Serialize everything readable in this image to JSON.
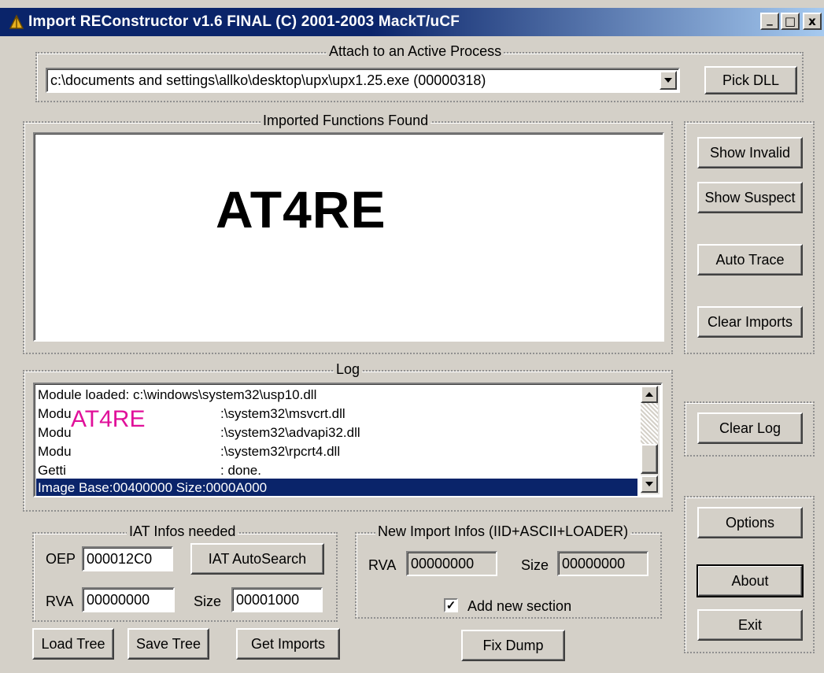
{
  "window": {
    "title": "Import REConstructor v1.6 FINAL (C) 2001-2003 MackT/uCF",
    "minimize": "_",
    "maximize": "□",
    "close": "x"
  },
  "attach": {
    "group_label": "Attach to an Active Process",
    "process": "c:\\documents and settings\\allko\\desktop\\upx\\upx1.25.exe (00000318)",
    "pick_dll": "Pick DLL"
  },
  "imports": {
    "group_label": "Imported Functions Found",
    "watermark": "AT4RE"
  },
  "right_panel": {
    "show_invalid": "Show Invalid",
    "show_suspect": "Show Suspect",
    "auto_trace": "Auto Trace",
    "clear_imports": "Clear Imports",
    "clear_log": "Clear Log",
    "options": "Options",
    "about": "About",
    "exit": "Exit"
  },
  "log": {
    "group_label": "Log",
    "lines": [
      "Module loaded: c:\\windows\\system32\\usp10.dll",
      "Modu",
      ":\\system32\\msvcrt.dll",
      "Modu",
      ":\\system32\\advapi32.dll",
      "Modu",
      ":\\system32\\rpcrt4.dll",
      "Getti",
      ": done."
    ],
    "selected": "Image Base:00400000 Size:0000A000",
    "watermark": "AT4RE",
    "watermark_color": "#e0109a"
  },
  "iat": {
    "group_label": "IAT Infos needed",
    "oep_label": "OEP",
    "oep_value": "000012C0",
    "autosearch": "IAT AutoSearch",
    "rva_label": "RVA",
    "rva_value": "00000000",
    "size_label": "Size",
    "size_value": "00001000"
  },
  "new_import": {
    "group_label": "New Import Infos (IID+ASCII+LOADER)",
    "rva_label": "RVA",
    "rva_value": "00000000",
    "size_label": "Size",
    "size_value": "00000000",
    "add_section_label": "Add new section",
    "add_section_checked": true
  },
  "bottom": {
    "load_tree": "Load Tree",
    "save_tree": "Save Tree",
    "get_imports": "Get Imports",
    "fix_dump": "Fix Dump"
  },
  "colors": {
    "face": "#d4d0c8",
    "titlebar": "#0a246a",
    "selection": "#0a246a"
  }
}
